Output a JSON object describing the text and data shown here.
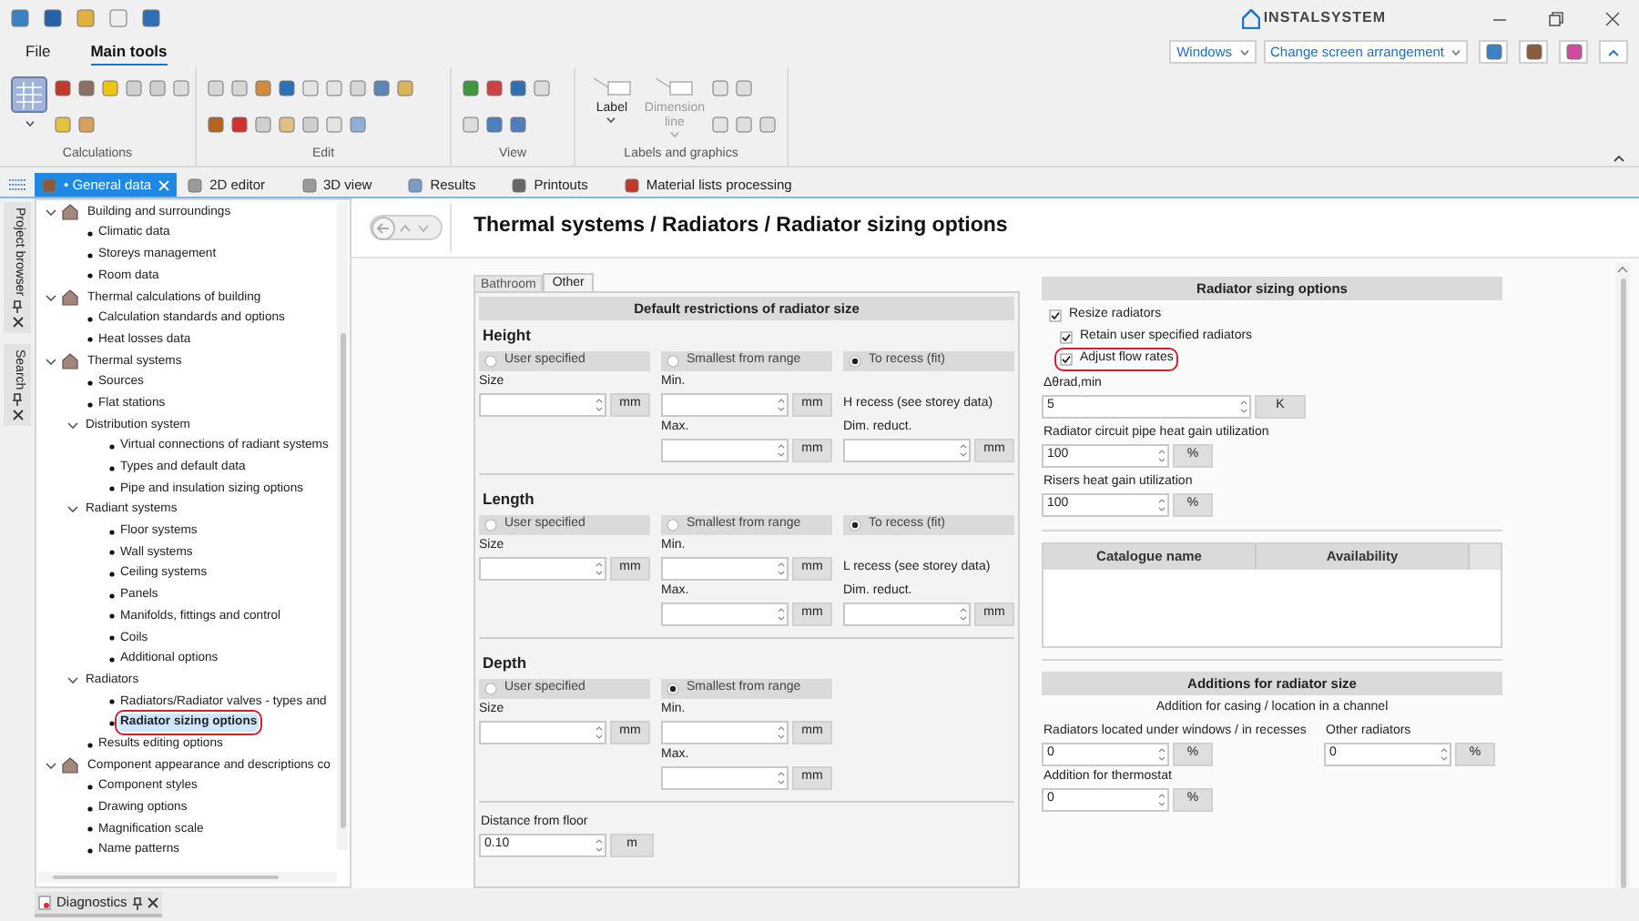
{
  "title_bar": {
    "logo": "INSTALSYSTEM"
  },
  "menu_tabs": [
    {
      "label": "File",
      "selected": false
    },
    {
      "label": "Main tools",
      "selected": true
    }
  ],
  "view_controls": {
    "dropdowns": [
      "Windows",
      "Change screen arrangement"
    ]
  },
  "ribbon": {
    "groups": [
      {
        "label": "Calculations"
      },
      {
        "label": "Edit"
      },
      {
        "label": "View"
      },
      {
        "label": "Labels and graphics",
        "buttons": [
          {
            "label": "Label",
            "disabled": false
          },
          {
            "label": "Dimension line",
            "disabled": true
          }
        ]
      }
    ]
  },
  "dock_tabs": [
    "Project browser",
    "Search"
  ],
  "document_tabs": [
    {
      "label": "• General data",
      "selected": true
    },
    {
      "label": "2D editor",
      "selected": false
    },
    {
      "label": "3D view",
      "selected": false
    },
    {
      "label": "Results",
      "selected": false
    },
    {
      "label": "Printouts",
      "selected": false
    },
    {
      "label": "Material lists processing",
      "selected": false
    }
  ],
  "tree": [
    {
      "label": "Building and surroundings",
      "expanded": true,
      "selected": false,
      "highlighted": false,
      "children": [
        {
          "label": "Climatic data",
          "selected": false,
          "highlighted": false
        },
        {
          "label": "Storeys management",
          "selected": false,
          "highlighted": false
        },
        {
          "label": "Room data",
          "selected": false,
          "highlighted": false
        }
      ]
    },
    {
      "label": "Thermal calculations of building",
      "expanded": true,
      "selected": false,
      "highlighted": false,
      "children": [
        {
          "label": "Calculation standards and options",
          "selected": false,
          "highlighted": false
        },
        {
          "label": "Heat losses data",
          "selected": false,
          "highlighted": false
        }
      ]
    },
    {
      "label": "Thermal systems",
      "expanded": true,
      "selected": false,
      "highlighted": false,
      "children": [
        {
          "label": "Sources",
          "selected": false,
          "highlighted": false
        },
        {
          "label": "Flat stations",
          "selected": false,
          "highlighted": false
        },
        {
          "label": "Distribution system",
          "expanded": true,
          "selected": false,
          "highlighted": false,
          "children": [
            {
              "label": "Virtual connections of radiant systems",
              "selected": false,
              "highlighted": false
            },
            {
              "label": "Types and default data",
              "selected": false,
              "highlighted": false
            },
            {
              "label": "Pipe and insulation sizing options",
              "selected": false,
              "highlighted": false
            }
          ]
        },
        {
          "label": "Radiant systems",
          "expanded": true,
          "selected": false,
          "highlighted": false,
          "children": [
            {
              "label": "Floor systems",
              "selected": false,
              "highlighted": false
            },
            {
              "label": "Wall systems",
              "selected": false,
              "highlighted": false
            },
            {
              "label": "Ceiling systems",
              "selected": false,
              "highlighted": false
            },
            {
              "label": "Panels",
              "selected": false,
              "highlighted": false
            },
            {
              "label": "Manifolds, fittings and control",
              "selected": false,
              "highlighted": false
            },
            {
              "label": "Coils",
              "selected": false,
              "highlighted": false
            },
            {
              "label": "Additional options",
              "selected": false,
              "highlighted": false
            }
          ]
        },
        {
          "label": "Radiators",
          "expanded": true,
          "selected": false,
          "highlighted": false,
          "children": [
            {
              "label": "Radiators/Radiator valves - types and",
              "selected": false,
              "highlighted": false
            },
            {
              "label": "Radiator sizing options",
              "selected": true,
              "highlighted": true
            }
          ]
        },
        {
          "label": "Results editing options",
          "selected": false,
          "highlighted": false
        }
      ]
    },
    {
      "label": "Component appearance and descriptions co",
      "expanded": true,
      "selected": false,
      "highlighted": false,
      "children": [
        {
          "label": "Component styles",
          "selected": false,
          "highlighted": false
        },
        {
          "label": "Drawing options",
          "selected": false,
          "highlighted": false
        },
        {
          "label": "Magnification scale",
          "selected": false,
          "highlighted": false
        },
        {
          "label": "Name patterns",
          "selected": false,
          "highlighted": false
        }
      ]
    }
  ],
  "page": {
    "title": "Thermal systems / Radiators / Radiator sizing options",
    "tabs": [
      {
        "label": "Bathroom",
        "selected": false
      },
      {
        "label": "Other",
        "selected": true
      }
    ],
    "restrictions": {
      "title": "Default restrictions of radiator size",
      "groups": [
        {
          "heading": "Height",
          "options": [
            {
              "label": "User specified",
              "selected": false,
              "fields": [
                {
                  "label": "Size",
                  "unit": "mm"
                }
              ]
            },
            {
              "label": "Smallest from range",
              "selected": false,
              "fields": [
                {
                  "label": "Min.",
                  "unit": "mm"
                },
                {
                  "label": "Max.",
                  "unit": "mm"
                }
              ]
            },
            {
              "label": "To recess (fit)",
              "selected": true,
              "note": "H recess (see storey data)",
              "fields": [
                {
                  "label": "Dim. reduct.",
                  "unit": "mm"
                }
              ]
            }
          ]
        },
        {
          "heading": "Length",
          "options": [
            {
              "label": "User specified",
              "selected": false,
              "fields": [
                {
                  "label": "Size",
                  "unit": "mm"
                }
              ]
            },
            {
              "label": "Smallest from range",
              "selected": false,
              "fields": [
                {
                  "label": "Min.",
                  "unit": "mm"
                },
                {
                  "label": "Max.",
                  "unit": "mm"
                }
              ]
            },
            {
              "label": "To recess (fit)",
              "selected": true,
              "note": "L recess (see storey data)",
              "fields": [
                {
                  "label": "Dim. reduct.",
                  "unit": "mm"
                }
              ]
            }
          ]
        },
        {
          "heading": "Depth",
          "options": [
            {
              "label": "User specified",
              "selected": false,
              "fields": [
                {
                  "label": "Size",
                  "unit": "mm"
                }
              ]
            },
            {
              "label": "Smallest from range",
              "selected": true,
              "fields": [
                {
                  "label": "Min.",
                  "unit": "mm"
                },
                {
                  "label": "Max.",
                  "unit": "mm"
                }
              ]
            }
          ]
        }
      ],
      "distance": {
        "label": "Distance from floor",
        "value": "0.10",
        "unit": "m"
      }
    },
    "sizing": {
      "title": "Radiator sizing options",
      "checks": [
        {
          "label": "Resize radiators",
          "checked": true,
          "highlighted": false,
          "children": [
            {
              "label": "Retain user specified radiators",
              "checked": true,
              "highlighted": false
            },
            {
              "label": "Adjust flow rates",
              "checked": true,
              "highlighted": true
            }
          ]
        }
      ],
      "fields": [
        {
          "label": "Δθrad,min",
          "value": "5",
          "unit": "K"
        },
        {
          "label": "Radiator circuit pipe heat gain utilization",
          "value": "100",
          "unit": "%"
        },
        {
          "label": "Risers heat gain utilization",
          "value": "100",
          "unit": "%"
        }
      ],
      "table": {
        "columns": [
          "Catalogue name",
          "Availability"
        ]
      }
    },
    "additions": {
      "title": "Additions for radiator size",
      "subtitle": "Addition for casing / location in a channel",
      "fields": [
        {
          "label": "Radiators located under windows / in recesses",
          "value": "0",
          "unit": "%"
        },
        {
          "label": "Other radiators",
          "value": "0",
          "unit": "%"
        },
        {
          "label": "Addition for thermostat",
          "value": "0",
          "unit": "%"
        }
      ]
    }
  },
  "bottom_panel": {
    "tab": "Diagnostics"
  }
}
